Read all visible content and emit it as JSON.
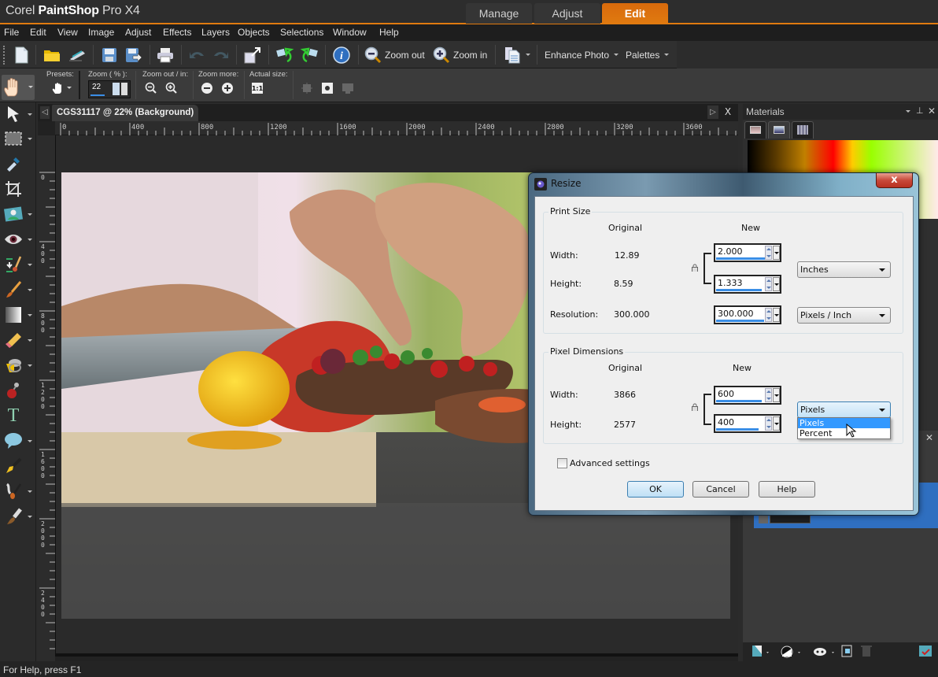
{
  "app": {
    "title_light": "Corel ",
    "title_bold": "PaintShop",
    "title_rest": " Pro X4"
  },
  "workspace_tabs": [
    {
      "label": "Manage",
      "active": false
    },
    {
      "label": "Adjust",
      "active": false
    },
    {
      "label": "Edit",
      "active": true
    }
  ],
  "menu": [
    "File",
    "Edit",
    "View",
    "Image",
    "Adjust",
    "Effects",
    "Layers",
    "Objects",
    "Selections",
    "Window",
    "Help"
  ],
  "toolbar": {
    "zoom_out_label": "Zoom out",
    "zoom_in_label": "Zoom in",
    "enhance_photo_label": "Enhance Photo",
    "palettes_label": "Palettes"
  },
  "tool_options": {
    "presets_label": "Presets:",
    "zoom_label": "Zoom ( % ):",
    "zoom_value": "22",
    "zoom_outin_label": "Zoom out / in:",
    "zoom_more_label": "Zoom more:",
    "actual_size_label": "Actual size:",
    "actual_size_glyph": "1:1"
  },
  "document": {
    "tab_title": "CGS31117 @  22% (Background)",
    "hruler_labels": [
      "0",
      "400",
      "800",
      "1200",
      "1600",
      "2000",
      "2400",
      "2800",
      "3200",
      "3600"
    ],
    "vruler_labels": [
      "0",
      "400",
      "800",
      "1200",
      "1600",
      "2000",
      "2400"
    ],
    "close_glyph": "X"
  },
  "materials": {
    "title": "Materials"
  },
  "status": {
    "text": "For Help, press F1"
  },
  "dialog": {
    "title": "Resize",
    "close_glyph": "x",
    "print_size": {
      "title": "Print Size",
      "original_header": "Original",
      "new_header": "New",
      "width_label": "Width:",
      "width_original": "12.89",
      "width_new": "2.000",
      "height_label": "Height:",
      "height_original": "8.59",
      "height_new": "1.333",
      "resolution_label": "Resolution:",
      "resolution_original": "300.000",
      "resolution_new": "300.000",
      "units": "Inches",
      "resolution_units": "Pixels / Inch"
    },
    "pixel_dimensions": {
      "title": "Pixel Dimensions",
      "original_header": "Original",
      "new_header": "New",
      "width_label": "Width:",
      "width_original": "3866",
      "width_new": "600",
      "height_label": "Height:",
      "height_original": "2577",
      "height_new": "400",
      "units": "Pixels",
      "units_options": [
        "Pixels",
        "Percent"
      ],
      "units_highlighted": "Pixels"
    },
    "advanced_settings_label": "Advanced settings",
    "advanced_settings_checked": false,
    "ok_label": "OK",
    "cancel_label": "Cancel",
    "help_label": "Help"
  }
}
